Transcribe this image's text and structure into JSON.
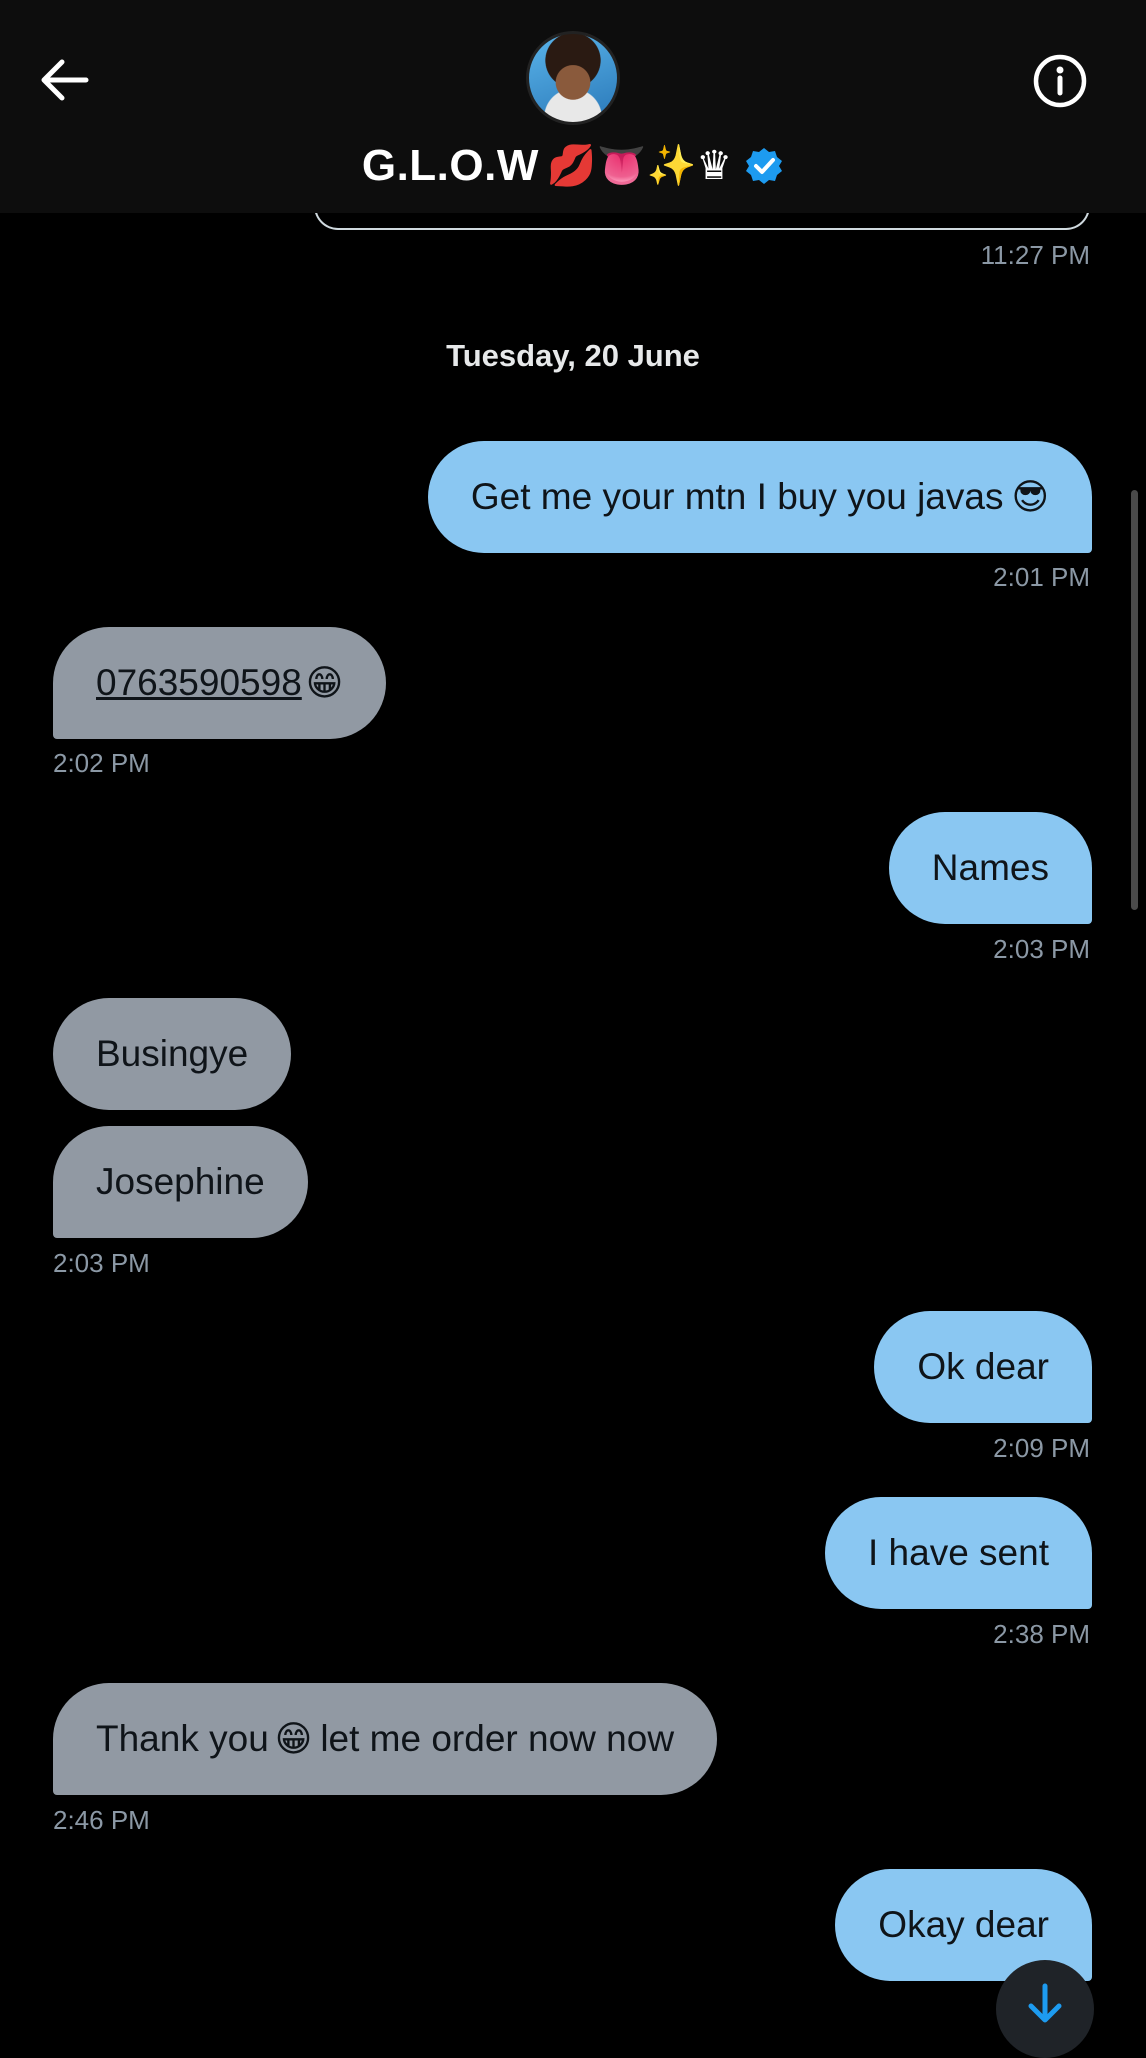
{
  "header": {
    "title": "G.L.O.W",
    "title_emojis": "💋👅✨♛",
    "icons": {
      "back": "arrow-left-icon",
      "info": "info-circle-icon",
      "verified": "verified-badge-icon"
    }
  },
  "previous": {
    "time": "11:27 PM"
  },
  "date_separator": "Tuesday, 20 June",
  "messages": [
    {
      "side": "sent",
      "text": "Get me your mtn I buy you javas",
      "emoji": "😎",
      "time": "2:01 PM"
    },
    {
      "side": "recv",
      "text": "0763590598",
      "emoji": "😁",
      "time": "2:02 PM"
    },
    {
      "side": "sent",
      "text": "Names",
      "time": "2:03 PM"
    },
    {
      "side": "recv",
      "text": "Busingye"
    },
    {
      "side": "recv",
      "text": "Josephine",
      "time": "2:03 PM"
    },
    {
      "side": "sent",
      "text": "Ok dear",
      "time": "2:09 PM"
    },
    {
      "side": "sent",
      "text": "I have sent",
      "time": "2:38 PM"
    },
    {
      "side": "recv",
      "text_a": "Thank you",
      "emoji": "😁",
      "text_b": "let me order now now",
      "time": "2:46 PM"
    },
    {
      "side": "sent",
      "text": "Okay dear"
    }
  ],
  "colors": {
    "sent_bubble": "#8ac7f2",
    "recv_bubble": "#9199a3",
    "background": "#000000",
    "timestamp": "#8b98a5"
  }
}
